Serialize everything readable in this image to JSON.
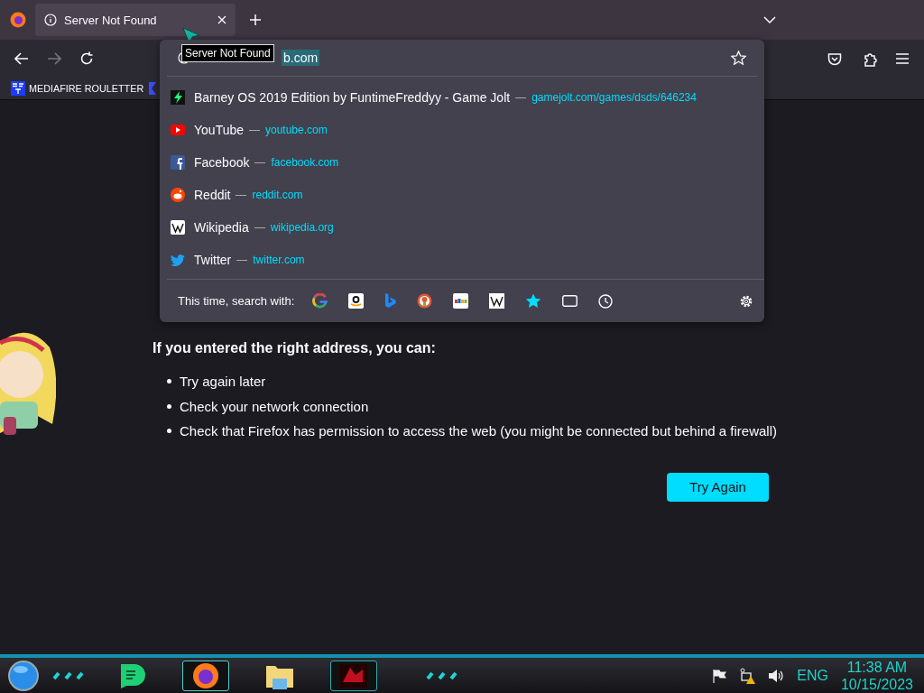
{
  "tab": {
    "title": "Server Not Found",
    "selected": true
  },
  "tooltip": "Server Not Found",
  "address_bar": {
    "value": "b.com"
  },
  "bookmarks": [
    {
      "label": "MEDIAFIRE ROULETTER"
    }
  ],
  "suggestions": [
    {
      "kind": "gamejolt",
      "title": "Barney OS 2019 Edition by FuntimeFreddyy - Game Jolt",
      "url": "gamejolt.com/games/dsds/646234"
    },
    {
      "kind": "youtube",
      "title": "YouTube",
      "url": "youtube.com"
    },
    {
      "kind": "facebook",
      "title": "Facebook",
      "url": "facebook.com"
    },
    {
      "kind": "reddit",
      "title": "Reddit",
      "url": "reddit.com"
    },
    {
      "kind": "wikipedia",
      "title": "Wikipedia",
      "url": "wikipedia.org"
    },
    {
      "kind": "twitter",
      "title": "Twitter",
      "url": "twitter.com"
    }
  ],
  "search_with": {
    "label": "This time, search with:"
  },
  "page": {
    "subheading": "If you entered the right address, you can:",
    "bullets": [
      "Try again later",
      "Check your network connection",
      "Check that Firefox has permission to access the web (you might be connected but behind a firewall)"
    ],
    "button": "Try Again"
  },
  "taskbar": {
    "language": "ENG",
    "time": "11:38 AM",
    "date": "10/15/2023"
  }
}
